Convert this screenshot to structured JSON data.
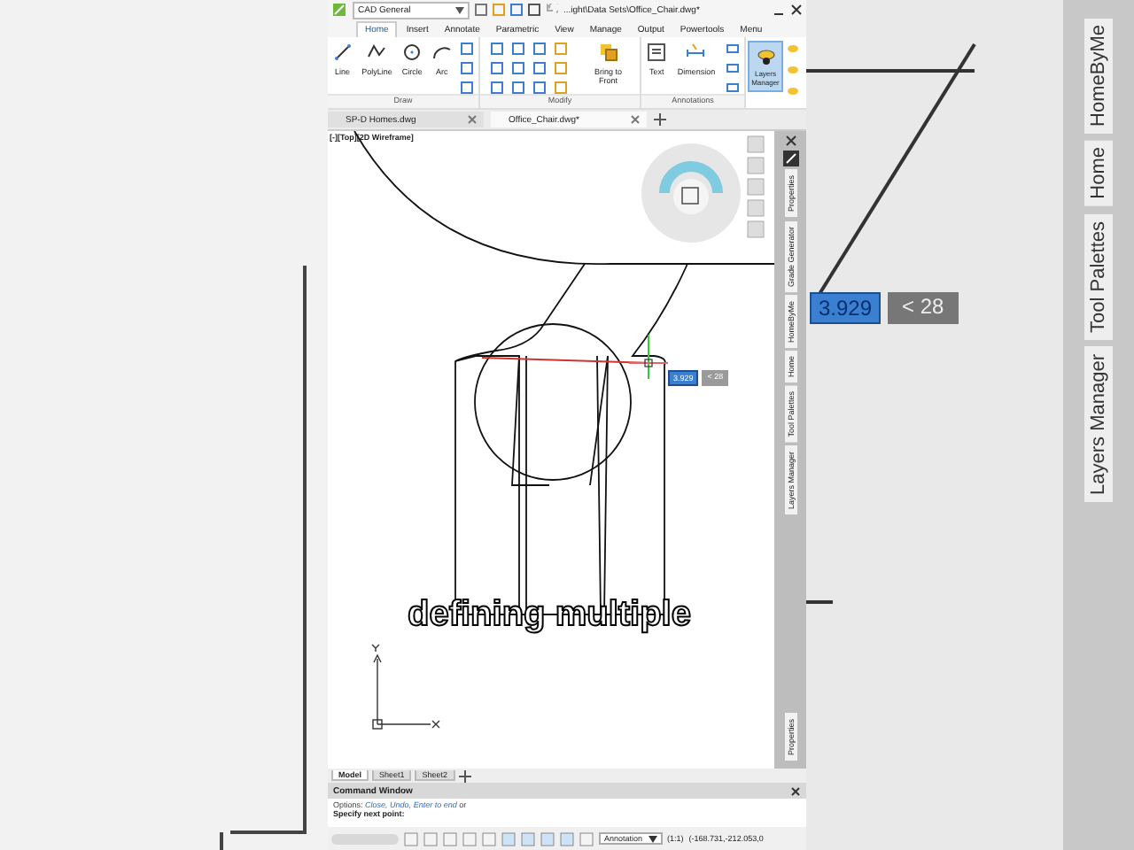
{
  "title_bar": {
    "workspace": "CAD General",
    "file_path": "...ight\\Data Sets\\Office_Chair.dwg*"
  },
  "ribbon_tabs": [
    {
      "label": "Home",
      "selected": true
    },
    {
      "label": "Insert",
      "selected": false
    },
    {
      "label": "Annotate",
      "selected": false
    },
    {
      "label": "Parametric",
      "selected": false
    },
    {
      "label": "View",
      "selected": false
    },
    {
      "label": "Manage",
      "selected": false
    },
    {
      "label": "Output",
      "selected": false
    },
    {
      "label": "Powertools",
      "selected": false
    },
    {
      "label": "Menu",
      "selected": false
    }
  ],
  "ribbon_groups": [
    {
      "label": "Draw",
      "tools": [
        "Line",
        "PolyLine",
        "Circle",
        "Arc"
      ]
    },
    {
      "label": "Modify",
      "tools": [
        "Bring to Front"
      ]
    },
    {
      "label": "Annotations",
      "tools": [
        "Text",
        "Dimension"
      ]
    }
  ],
  "layers_button": {
    "label": "Layers Manager",
    "selected": true
  },
  "document_tabs": [
    {
      "label": "SP-D Homes.dwg",
      "selected": false
    },
    {
      "label": "Office_Chair.dwg*",
      "selected": true
    }
  ],
  "viewport": {
    "label": "[-][Top][2D Wireframe]",
    "dynamic_input": {
      "value": "3.929",
      "angle": "< 28"
    }
  },
  "side_tabs": [
    "Properties",
    "Grade Generator",
    "HomeByMe",
    "Home",
    "Tool Palettes",
    "Layers Manager"
  ],
  "side_bottom_tab": "Properties",
  "layout_tabs": [
    {
      "label": "Model",
      "selected": true
    },
    {
      "label": "Sheet1",
      "selected": false
    },
    {
      "label": "Sheet2",
      "selected": false
    }
  ],
  "command_window": {
    "title": "Command Window",
    "options_prefix": "Options:",
    "options": [
      "Close,",
      "Undo,",
      "Enter to end"
    ],
    "options_suffix": "or",
    "prompt": "Specify next point:"
  },
  "status_bar": {
    "annotation": "Annotation",
    "scale": "(1:1)",
    "coordinates": "(-168.731,-212.053,0"
  },
  "caption": "defining multiple",
  "blurred_right": {
    "value": "3.929",
    "angle": "< 28",
    "tabs": [
      "HomeByMe",
      "Home",
      "Tool Palettes",
      "Layers Manager"
    ]
  }
}
